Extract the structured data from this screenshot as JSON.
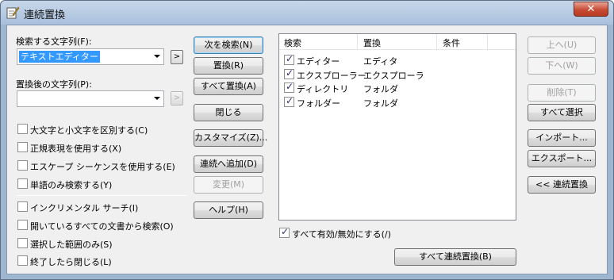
{
  "window": {
    "title": "連続置換",
    "close_label": "✕"
  },
  "search": {
    "label": "検索する文字列(F):",
    "value": "テキストエディター",
    "arrow_label": ">"
  },
  "replace": {
    "label": "置換後の文字列(P):",
    "value": "",
    "arrow_label": ">"
  },
  "options": [
    {
      "label": "大文字と小文字を区別する(C)",
      "checked": false
    },
    {
      "label": "正規表現を使用する(X)",
      "checked": false
    },
    {
      "label": "エスケープ シーケンスを使用する(E)",
      "checked": false
    },
    {
      "label": "単語のみ検索する(Y)",
      "checked": false
    },
    {
      "label": "インクリメンタル サーチ(I)",
      "checked": false
    },
    {
      "label": "開いているすべての文書から検索(O)",
      "checked": false
    },
    {
      "label": "選択した範囲のみ(S)",
      "checked": false
    },
    {
      "label": "終了したら閉じる(L)",
      "checked": false
    }
  ],
  "middle_buttons": {
    "find_next": "次を検索(N)",
    "replace": "置換(R)",
    "replace_all": "すべて置換(A)",
    "close": "閉じる",
    "customize": "カスタマイズ(Z)...",
    "add_to_batch": "連続へ追加(D)",
    "change": "変更(M)",
    "help": "ヘルプ(H)"
  },
  "list": {
    "columns": [
      "検索",
      "置換",
      "条件"
    ],
    "rows": [
      {
        "find": "エディター",
        "replace": "エディタ",
        "cond": "",
        "checked": true
      },
      {
        "find": "エクスプローラー",
        "replace": "エクスプローラ",
        "cond": "",
        "checked": true
      },
      {
        "find": "ディレクトリ",
        "replace": "フォルダ",
        "cond": "",
        "checked": true
      },
      {
        "find": "フォルダー",
        "replace": "フォルダ",
        "cond": "",
        "checked": true
      }
    ],
    "toggle_all_label": "すべて有効/無効にする(/)",
    "toggle_all_checked": true,
    "run_all_label": "すべて連続置換(B)"
  },
  "right_buttons": {
    "up": "上へ(U)",
    "down": "下へ(W)",
    "delete": "削除(T)",
    "select_all": "すべて選択",
    "import": "インポート...",
    "export": "エクスポート...",
    "batch_replace": "<< 連続置換"
  }
}
